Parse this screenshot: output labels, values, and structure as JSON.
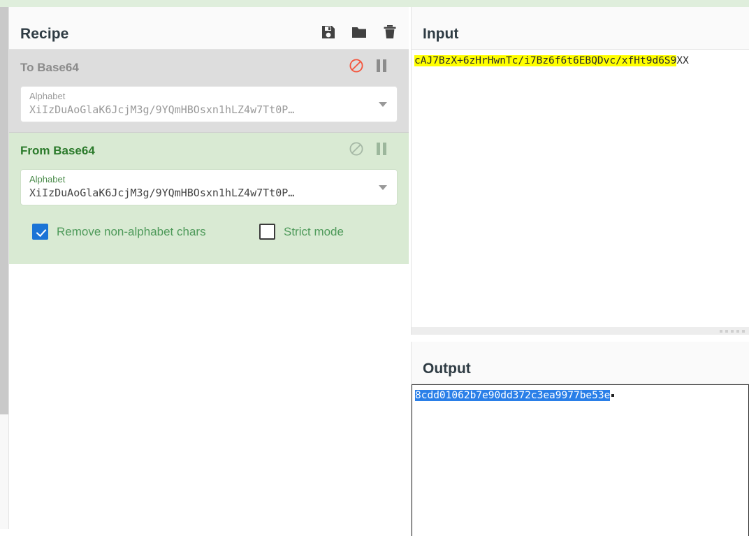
{
  "recipe": {
    "title": "Recipe",
    "title_icons": [
      {
        "name": "save-icon",
        "label": "Save recipe"
      },
      {
        "name": "folder-icon",
        "label": "Load recipe"
      },
      {
        "name": "trash-icon",
        "label": "Clear recipe"
      }
    ],
    "operations": [
      {
        "name": "To Base64",
        "state": "disabled",
        "disable_icon": "disable-icon",
        "pause_icon": "pause-icon",
        "args": [
          {
            "label": "Alphabet",
            "value": "XiIzDuAoGlaK6JcjM3g/9YQmHBOsxn1hLZ4w7Tt0P…",
            "type": "editable-select"
          }
        ],
        "checkboxes": []
      },
      {
        "name": "From Base64",
        "state": "active",
        "disable_icon": "disable-icon",
        "pause_icon": "pause-icon",
        "args": [
          {
            "label": "Alphabet",
            "value": "XiIzDuAoGlaK6JcjM3g/9YQmHBOsxn1hLZ4w7Tt0P…",
            "type": "editable-select"
          }
        ],
        "checkboxes": [
          {
            "label": "Remove non-alphabet chars",
            "checked": true
          },
          {
            "label": "Strict mode",
            "checked": false
          }
        ]
      }
    ]
  },
  "input": {
    "title": "Input",
    "highlighted_text": "cAJ7BzX+6zHrHwnTc/i7Bz6f6t6EBQDvc/xfHt9d6S9",
    "trailing_text": "XX",
    "highlight_color": "#ffff00"
  },
  "output": {
    "title": "Output",
    "selected_text": "8cdd01062b7e90dd372c3ea9977be53e",
    "selection_color": "#2a7fe8"
  },
  "colors": {
    "active_op_bg": "#d9ead3",
    "disabled_op_bg": "#dddddd",
    "active_op_text": "#2b7a2b",
    "disabled_op_text": "#8b8b8b",
    "checkbox_checked": "#1b74d6",
    "disable_icon_active": "#f4553d",
    "page_green": "#dfeedc"
  }
}
